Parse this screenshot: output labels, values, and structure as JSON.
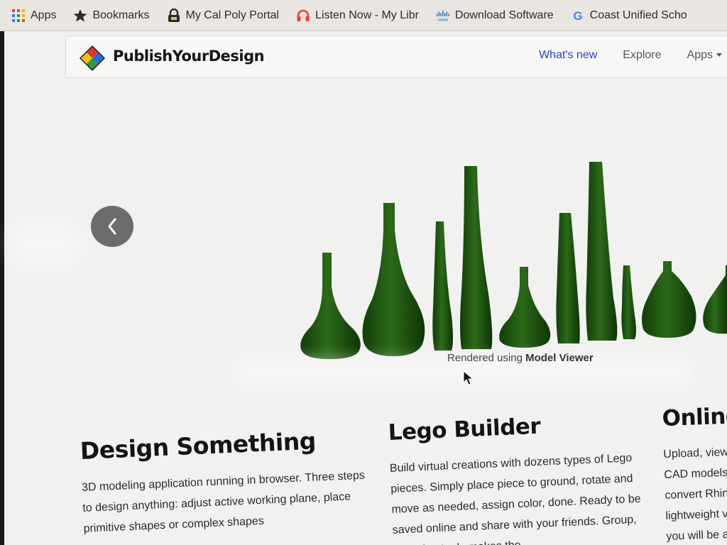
{
  "bookmarks": [
    {
      "label": "Apps",
      "icon": "apps-grid-icon"
    },
    {
      "label": "Bookmarks",
      "icon": "star-icon"
    },
    {
      "label": "My Cal Poly Portal",
      "icon": "lock-icon"
    },
    {
      "label": "Listen Now - My Libr",
      "icon": "headphones-icon"
    },
    {
      "label": "Download Software",
      "icon": "cisco-icon"
    },
    {
      "label": "Coast Unified Scho",
      "icon": "google-icon"
    }
  ],
  "nav": {
    "brand": "PublishYourDesign",
    "links": [
      {
        "label": "What's new",
        "active": true
      },
      {
        "label": "Explore",
        "active": false
      },
      {
        "label": "Apps",
        "active": false
      }
    ]
  },
  "carousel": {
    "caption_prefix": "Rendered using",
    "caption_bold": "Model Viewer"
  },
  "features": [
    {
      "title": "Design Something",
      "body": "3D modeling application running in browser. Three steps to design anything: adjust active working plane, place primitive shapes or complex shapes"
    },
    {
      "title": "Lego Builder",
      "body": "Build virtual creations with dozens types of Lego pieces. Simply place piece to ground, rotate and move as needed, assign color, done. Ready to be saved online and share with your friends. Group, selection tools makes the"
    },
    {
      "title": "Online",
      "body": "Upload, view, CAD models. convert Rhino lightweight vis you will be ab"
    }
  ],
  "colors": {
    "vase_green": "#1f5a12",
    "nav_active": "#2a3fd0",
    "page_bg": "#f1f2f0"
  }
}
